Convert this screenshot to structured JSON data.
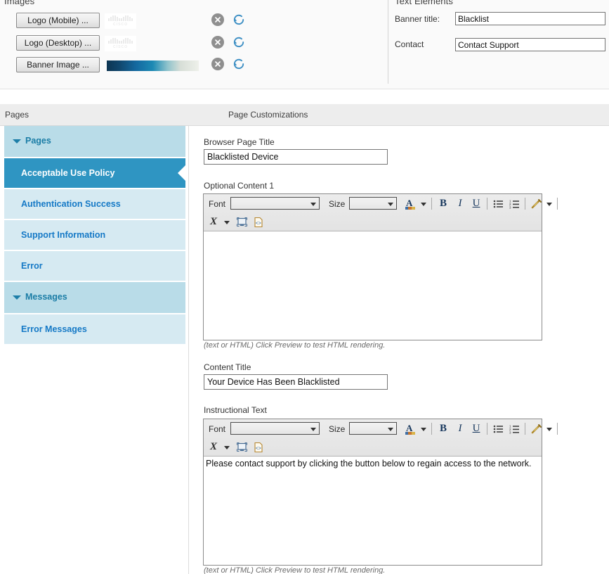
{
  "top_panel": {
    "images_section_title": "Images",
    "text_section_title": "Text Elements",
    "image_rows": [
      {
        "button_label": "Logo (Mobile) ...",
        "thumbnail": "cisco-logo-thumbnail",
        "clear_icon": "close-circle-icon",
        "reset_icon": "refresh-icon"
      },
      {
        "button_label": "Logo (Desktop) ...",
        "thumbnail": "cisco-logo-thumbnail",
        "clear_icon": "close-circle-icon",
        "reset_icon": "refresh-icon"
      },
      {
        "button_label": "Banner Image ...",
        "thumbnail": "banner-gradient-thumbnail",
        "clear_icon": "close-circle-icon",
        "reset_icon": "refresh-icon"
      }
    ],
    "text_rows": [
      {
        "label": "Banner title:",
        "value": "Blacklist",
        "placeholder": ""
      },
      {
        "label": "Contact",
        "value": "Contact Support",
        "placeholder": ""
      }
    ]
  },
  "header_bar": {
    "left_title": "Pages",
    "right_title": "Page Customizations"
  },
  "sidebar": {
    "items": [
      {
        "label": "Pages",
        "type": "group",
        "expanded": true,
        "selected": false
      },
      {
        "label": "Acceptable Use Policy",
        "type": "child",
        "selected": true
      },
      {
        "label": "Authentication Success",
        "type": "child",
        "selected": false
      },
      {
        "label": "Support Information",
        "type": "child",
        "selected": false
      },
      {
        "label": "Error",
        "type": "child",
        "selected": false
      },
      {
        "label": "Messages",
        "type": "group",
        "expanded": true,
        "selected": false
      },
      {
        "label": "Error Messages",
        "type": "child",
        "selected": false
      }
    ]
  },
  "main": {
    "browser_page_title": {
      "label": "Browser Page Title",
      "value": "Blacklisted Device",
      "placeholder": ""
    },
    "optional_content_1": {
      "label": "Optional Content 1",
      "value": "",
      "hint": "(text or HTML) Click Preview to test HTML rendering."
    },
    "content_title": {
      "label": "Content Title",
      "value": "Your Device Has Been Blacklisted",
      "placeholder": ""
    },
    "instructional_text": {
      "label": "Instructional Text",
      "value": "Please contact support by clicking the button below to regain access to the network.",
      "hint": "(text or HTML) Click Preview to test HTML rendering."
    },
    "editor_toolbar": {
      "font_label": "Font",
      "font_value": "",
      "size_label": "Size",
      "size_value": "",
      "buttons": [
        {
          "name": "font-color-icon",
          "glyph": "A"
        },
        {
          "name": "bold-icon",
          "glyph": "B"
        },
        {
          "name": "italic-icon",
          "glyph": "I"
        },
        {
          "name": "underline-icon",
          "glyph": "U"
        },
        {
          "name": "bulleted-list-icon",
          "glyph": "☰"
        },
        {
          "name": "numbered-list-icon",
          "glyph": "☰"
        },
        {
          "name": "link-icon",
          "glyph": "✐"
        },
        {
          "name": "clear-formatting-icon",
          "glyph": "X"
        },
        {
          "name": "preview-icon",
          "glyph": "▣"
        },
        {
          "name": "source-code-icon",
          "glyph": "◇"
        }
      ]
    }
  },
  "colors": {
    "accent_selected": "#2f95c2",
    "group_header": "#b9dce8",
    "child_item": "#d6eaf2",
    "link_blue": "#1579c6",
    "header_bar": "#ededed",
    "panel_bg": "#fafafa"
  }
}
